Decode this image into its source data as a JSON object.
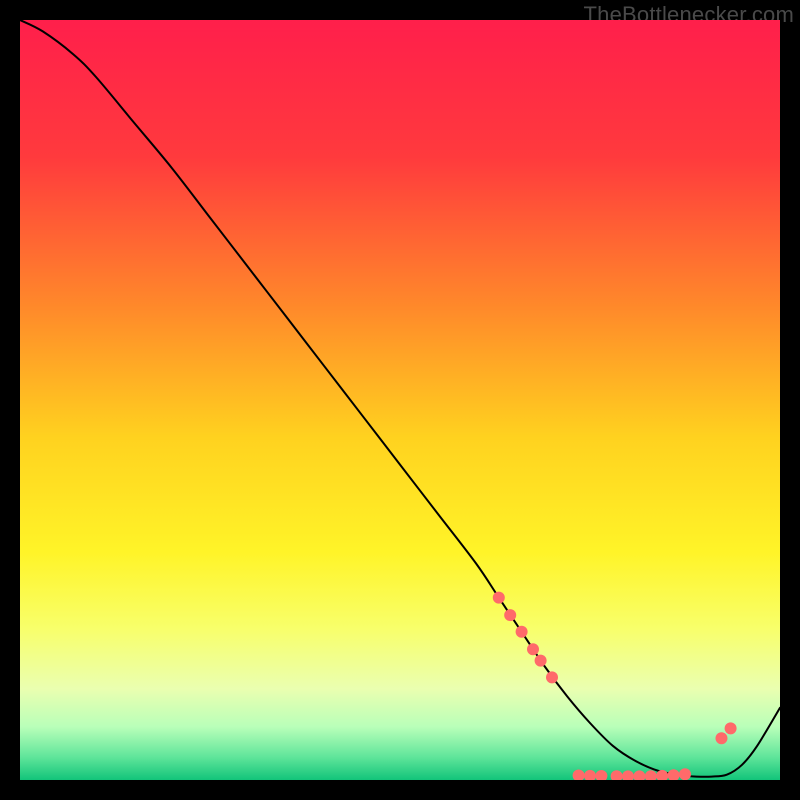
{
  "watermark": "TheBottlenecker.com",
  "chart_data": {
    "type": "line",
    "title": "",
    "xlabel": "",
    "ylabel": "",
    "xlim": [
      0,
      100
    ],
    "ylim": [
      0,
      100
    ],
    "background_gradient": {
      "stops": [
        {
          "offset": 0,
          "color": "#ff1f4b"
        },
        {
          "offset": 18,
          "color": "#ff3a3d"
        },
        {
          "offset": 38,
          "color": "#ff8a2a"
        },
        {
          "offset": 55,
          "color": "#ffd21f"
        },
        {
          "offset": 70,
          "color": "#fff428"
        },
        {
          "offset": 80,
          "color": "#f8ff6a"
        },
        {
          "offset": 88,
          "color": "#eaffb0"
        },
        {
          "offset": 93,
          "color": "#b9ffb9"
        },
        {
          "offset": 97,
          "color": "#5fe59a"
        },
        {
          "offset": 100,
          "color": "#12c47a"
        }
      ]
    },
    "series": [
      {
        "name": "curve",
        "color": "#000000",
        "width": 2,
        "x": [
          0,
          3,
          7,
          10,
          15,
          20,
          25,
          30,
          35,
          40,
          45,
          50,
          55,
          60,
          63,
          66,
          69,
          72,
          75,
          78,
          81,
          84,
          87,
          89,
          91,
          93,
          95,
          97,
          100
        ],
        "y": [
          100,
          98.5,
          95.5,
          92.5,
          86.5,
          80.5,
          74,
          67.5,
          61,
          54.5,
          48,
          41.5,
          35,
          28.5,
          24,
          19.5,
          15,
          11,
          7.5,
          4.5,
          2.5,
          1.2,
          0.6,
          0.45,
          0.45,
          0.7,
          2.0,
          4.5,
          9.5
        ]
      }
    ],
    "markers": {
      "color": "#ff6a6a",
      "radius": 6,
      "points": [
        {
          "x": 63.0,
          "y": 24.0
        },
        {
          "x": 64.5,
          "y": 21.7
        },
        {
          "x": 66.0,
          "y": 19.5
        },
        {
          "x": 67.5,
          "y": 17.2
        },
        {
          "x": 68.5,
          "y": 15.7
        },
        {
          "x": 70.0,
          "y": 13.5
        },
        {
          "x": 73.5,
          "y": 0.6
        },
        {
          "x": 75.0,
          "y": 0.55
        },
        {
          "x": 76.5,
          "y": 0.52
        },
        {
          "x": 78.5,
          "y": 0.5
        },
        {
          "x": 80.0,
          "y": 0.48
        },
        {
          "x": 81.5,
          "y": 0.48
        },
        {
          "x": 83.0,
          "y": 0.5
        },
        {
          "x": 84.5,
          "y": 0.55
        },
        {
          "x": 86.0,
          "y": 0.62
        },
        {
          "x": 87.5,
          "y": 0.75
        },
        {
          "x": 92.3,
          "y": 5.5
        },
        {
          "x": 93.5,
          "y": 6.8
        }
      ]
    }
  }
}
